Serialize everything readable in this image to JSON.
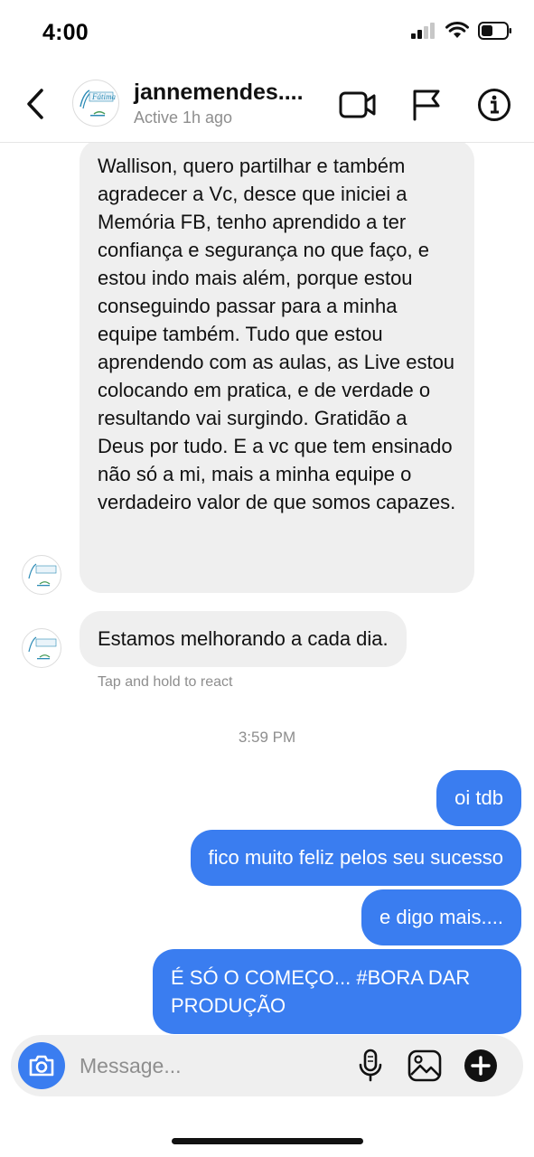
{
  "status_bar": {
    "time": "4:00"
  },
  "header": {
    "name": "jannemendes....",
    "status": "Active 1h ago",
    "avatar_text": "Fátima",
    "icons": [
      "back-icon",
      "video-call-icon",
      "flag-icon",
      "info-icon"
    ]
  },
  "messages": {
    "received_1": "Wallison, quero partilhar e também agradecer a Vc, desce que iniciei a Memória FB, tenho aprendido a ter confiança e segurança no que faço, e estou indo mais além, porque estou conseguindo passar para a minha equipe também. Tudo que estou aprendendo com as aulas, as Live estou colocando em pratica, e de verdade o resultando vai surgindo. Gratidão a Deus por tudo. E a vc que tem ensinado não só a mi, mais a minha equipe o verdadeiro valor de que somos capazes.",
    "received_2": "Estamos melhorando a cada dia.",
    "tap_hint": "Tap and hold to react",
    "timestamp": "3:59 PM",
    "sent": [
      "oi tdb",
      "fico muito feliz pelos seu sucesso",
      "e digo mais....",
      "É SÓ O COMEÇO... #BORA DAR PRODUÇÃO"
    ]
  },
  "composer": {
    "placeholder": "Message...",
    "icons": [
      "camera-icon",
      "microphone-icon",
      "gallery-icon",
      "plus-icon"
    ]
  },
  "colors": {
    "sent_bubble": "#3a7df0",
    "received_bubble": "#efefef",
    "muted_text": "#8e8e8e"
  }
}
